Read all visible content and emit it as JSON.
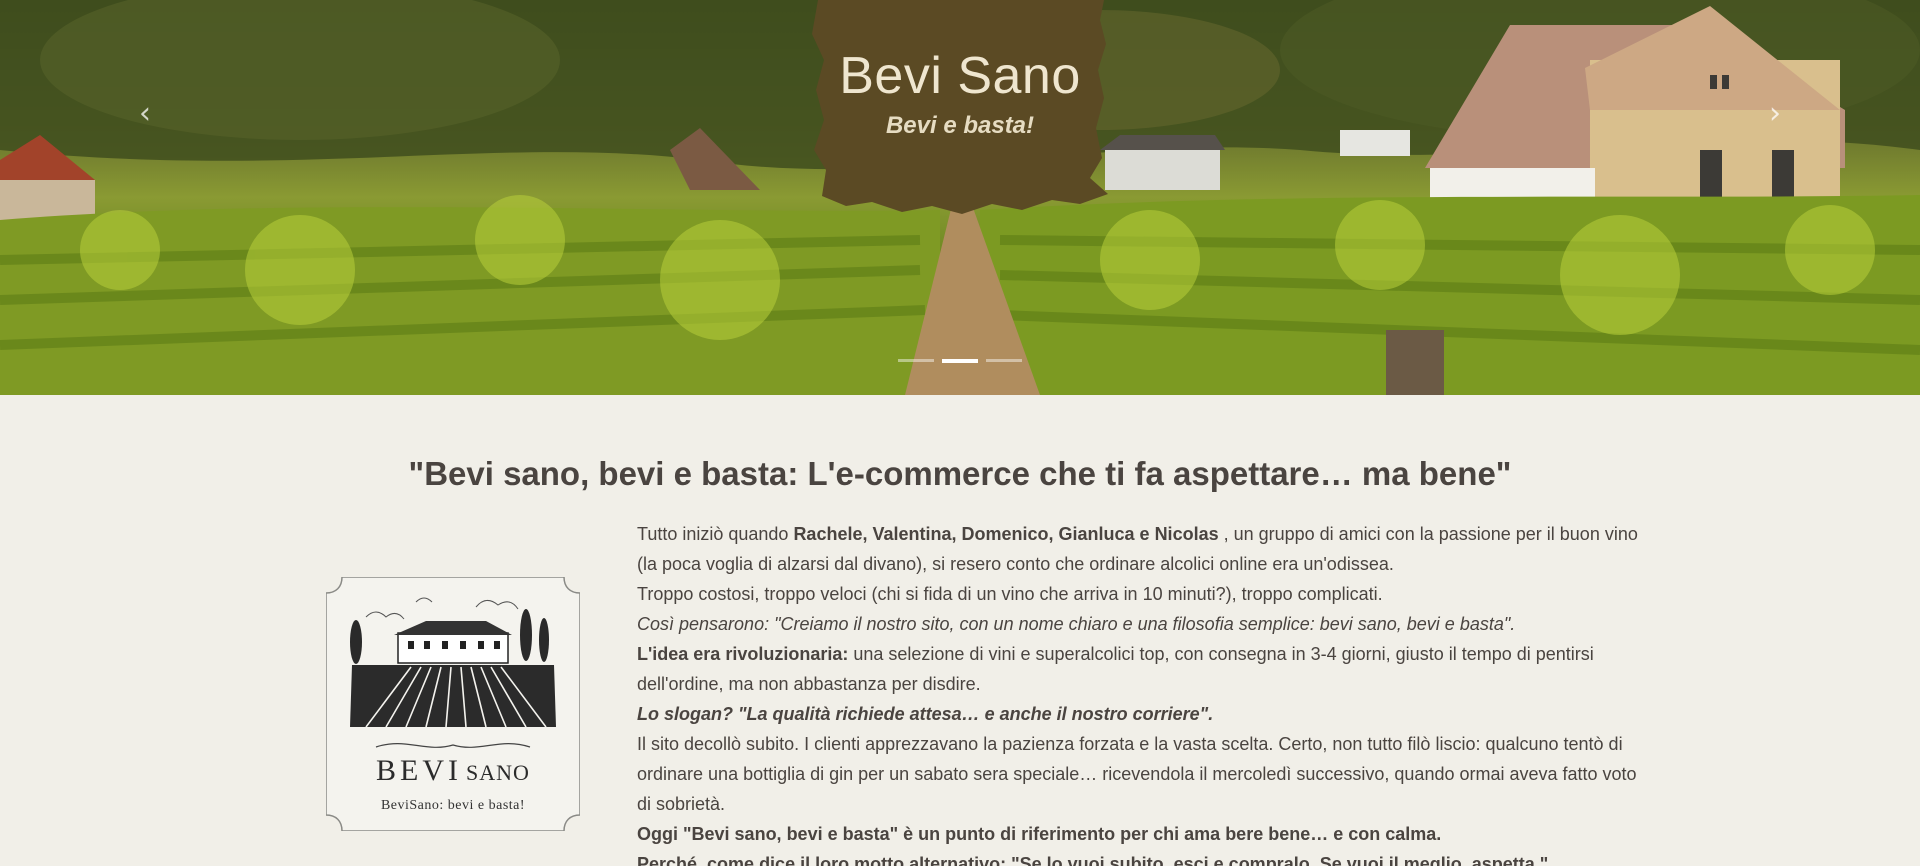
{
  "hero": {
    "brand_title": "Bevi Sano",
    "brand_subtitle": "Bevi e basta!",
    "prev_icon": "chevron-left-icon",
    "next_icon": "chevron-right-icon",
    "prev_glyph": "‹",
    "next_glyph": "›",
    "slide_count": 3,
    "active_slide": 2
  },
  "headline": "\"Bevi sano, bevi e basta: L'e-commerce che ti fa aspettare… ma bene\"",
  "logo": {
    "word_bevi": "BEVI",
    "word_sano": "SANO",
    "tagline": "BeviSano: bevi e basta!"
  },
  "story": {
    "p1_a": "Tutto iniziò quando ",
    "p1_names": "Rachele, Valentina, Domenico, Gianluca e Nicolas",
    "p1_b": " , un gruppo di amici con la passione per il buon vino (la poca voglia di alzarsi dal divano), si resero conto che ordinare alcolici online era un'odissea.",
    "p2": "Troppo costosi, troppo veloci (chi si fida di un vino che arriva in 10 minuti?), troppo complicati.",
    "p3": "Così pensarono: \"Creiamo il nostro sito, con un nome chiaro e una filosofia semplice: bevi sano, bevi e basta\".",
    "p4_bold": "L'idea era rivoluzionaria:",
    "p4_rest": " una selezione di vini e superalcolici top, con consegna in 3-4 giorni, giusto il tempo di pentirsi dell'ordine, ma non abbastanza per disdire.",
    "p5": "Lo slogan? \"La qualità richiede attesa… e anche il nostro corriere\".",
    "p6": "Il sito decollò subito. I clienti apprezzavano la pazienza forzata e la vasta scelta. Certo, non tutto filò liscio: qualcuno tentò di ordinare una bottiglia di gin per un sabato sera speciale… ricevendola il mercoledì successivo, quando ormai aveva fatto voto di sobrietà.",
    "p7": "Oggi \"Bevi sano, bevi e basta\" è un punto di riferimento per chi ama bere bene… e con calma.",
    "p8": "Perché, come dice il loro motto alternativo: \"Se lo vuoi subito, esci e compralo. Se vuoi il meglio, aspetta.\""
  },
  "colors": {
    "background": "#f1efe8",
    "badge": "#5b4a24",
    "text": "#4a4440"
  }
}
